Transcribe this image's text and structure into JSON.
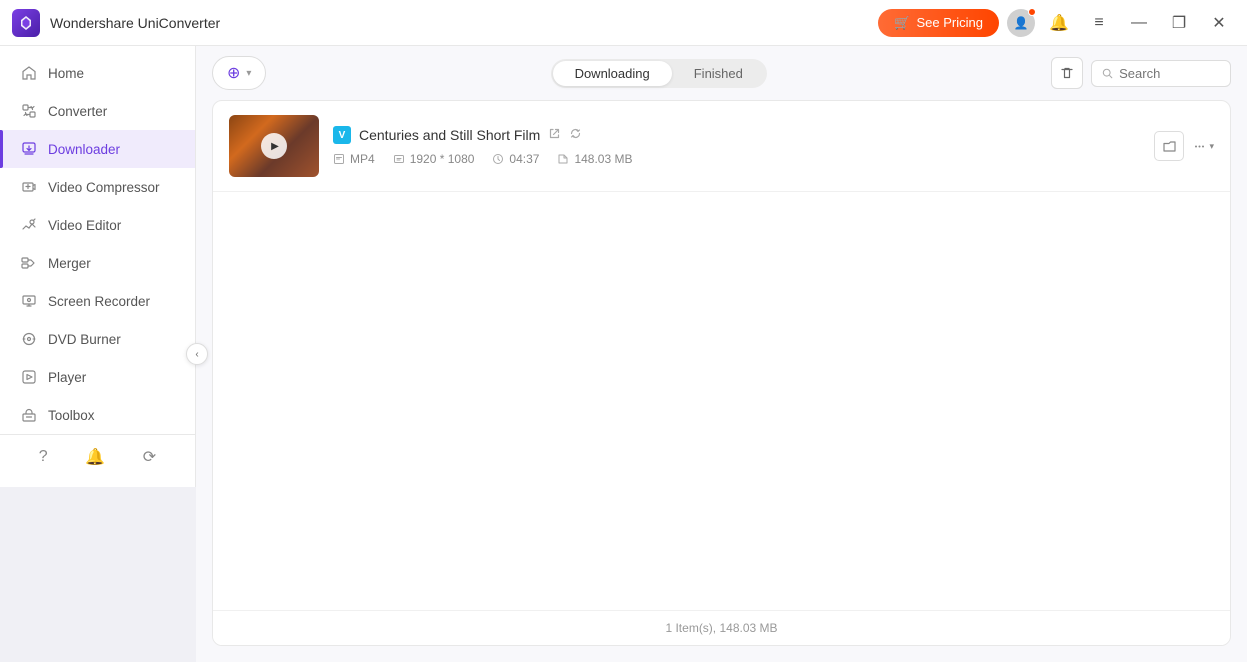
{
  "app": {
    "title": "Wondershare UniConverter",
    "logo_alt": "UniConverter Logo"
  },
  "titlebar": {
    "see_pricing_label": "See Pricing",
    "cart_icon": "🛒",
    "minimize_icon": "—",
    "maximize_icon": "❐",
    "close_icon": "✕",
    "menu_icon": "≡",
    "bell_icon": "🔔"
  },
  "sidebar": {
    "items": [
      {
        "id": "home",
        "label": "Home",
        "icon": "home"
      },
      {
        "id": "converter",
        "label": "Converter",
        "icon": "converter"
      },
      {
        "id": "downloader",
        "label": "Downloader",
        "icon": "downloader",
        "active": true
      },
      {
        "id": "video-compressor",
        "label": "Video Compressor",
        "icon": "compress"
      },
      {
        "id": "video-editor",
        "label": "Video Editor",
        "icon": "edit"
      },
      {
        "id": "merger",
        "label": "Merger",
        "icon": "merge"
      },
      {
        "id": "screen-recorder",
        "label": "Screen Recorder",
        "icon": "screen"
      },
      {
        "id": "dvd-burner",
        "label": "DVD Burner",
        "icon": "dvd"
      },
      {
        "id": "player",
        "label": "Player",
        "icon": "play"
      },
      {
        "id": "toolbox",
        "label": "Toolbox",
        "icon": "toolbox"
      }
    ],
    "bottom_icons": [
      "help",
      "notification",
      "feedback"
    ]
  },
  "tabs": {
    "downloading_label": "Downloading",
    "finished_label": "Finished",
    "active": "downloading"
  },
  "topbar": {
    "add_btn_label": "Add",
    "search_placeholder": "Search"
  },
  "file_item": {
    "title": "Centuries and Still Short Film",
    "source": "V",
    "source_color": "#1ab7ea",
    "format": "MP4",
    "resolution": "1920 * 1080",
    "duration": "04:37",
    "size": "148.03 MB",
    "thumbnail_alt": "Centuries and Still Short Film thumbnail"
  },
  "status_bar": {
    "text": "1 Item(s), 148.03 MB"
  },
  "colors": {
    "active_nav": "#6c3de0",
    "accent": "#ff5722",
    "tab_active_bg": "#ffffff"
  }
}
